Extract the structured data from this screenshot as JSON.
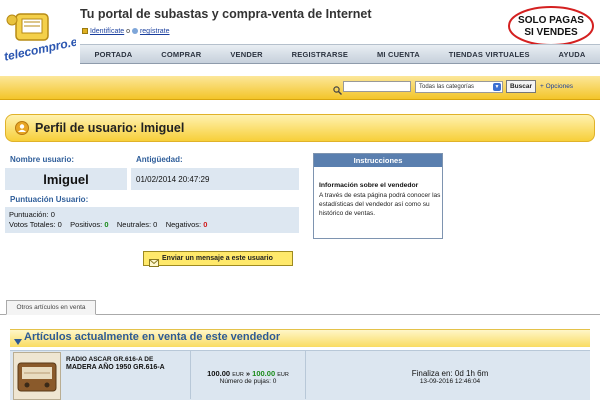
{
  "header": {
    "site_title": "Tu portal de subastas y compra-venta de Internet",
    "login_link": "Identifícate",
    "login_sep": " o ",
    "register_link": "regístrate",
    "slogan_line1": "SOLO PAGAS",
    "slogan_line2": "SI VENDES",
    "logo_text": "telecompro.es"
  },
  "nav": {
    "items": [
      "PORTADA",
      "COMPRAR",
      "VENDER",
      "REGISTRARSE",
      "MI CUENTA",
      "TIENDAS VIRTUALES",
      "AYUDA"
    ]
  },
  "search": {
    "input_value": "",
    "category_selected": "Todas las categorías",
    "button_label": "Buscar",
    "options_link": "+ Opciones"
  },
  "profile": {
    "title": "Perfil de usuario: lmiguel",
    "label_user": "Nombre usuario:",
    "label_age": "Antigüedad:",
    "username": "lmiguel",
    "since": "01/02/2014 20:47:29",
    "label_score": "Puntuación Usuario:",
    "score_label": "Puntuación:",
    "score_value": "0",
    "votes_label": "Votos Totales:",
    "votes_value": "0",
    "positive_label": "Positivos:",
    "positive_value": "0",
    "neutral_label": "Neutrales:",
    "neutral_value": "0",
    "negative_label": "Negativos:",
    "negative_value": "0"
  },
  "instructions": {
    "title": "Instrucciones",
    "heading": "Información sobre el vendedor",
    "text": "A través de esta página podrá conocer las estadísticas del vendedor así como su histórico de ventas."
  },
  "message_button": "Enviar un mensaje a este usuario",
  "tabs": {
    "active": "Otros artículos en venta"
  },
  "for_sale": {
    "title": "Artículos actualmente en venta de este vendedor",
    "items": [
      {
        "title_line1": "RADIO ASCAR GR.616-A DE",
        "title_line2": "MADERA AÑO 1950 GR.616-A",
        "price": "100.00",
        "currency": "EUR",
        "arrow": "»",
        "bid_price": "100.00",
        "bids_label": "Número de pujas:",
        "bids_value": "0",
        "ends_label": "Finaliza en:",
        "ends_value": "0d 1h 6m",
        "end_date": "13-09-2016 12:46:04"
      }
    ]
  },
  "colors": {
    "accent_yellow": "#f7cf3a",
    "nav_text": "#2b3340",
    "link_blue": "#1a3f9e",
    "label_blue": "#2f5e9a",
    "positive_green": "#1a8b1a",
    "negative_red": "#d01818"
  },
  "icons": {
    "search": "magnifier-icon",
    "profile": "user-icon",
    "message": "envelope-icon",
    "sale": "triangle-down-icon"
  }
}
